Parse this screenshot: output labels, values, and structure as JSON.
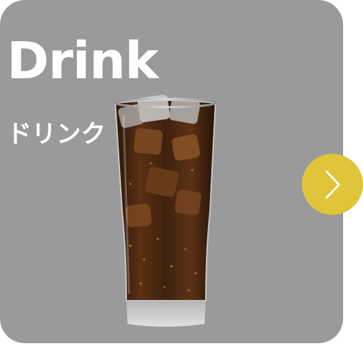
{
  "card": {
    "title_en": "Drink",
    "title_ja": "ドリンク",
    "image_icon": "iced-cola-glass-image",
    "background_color": "#9a9a9a"
  },
  "navigation": {
    "next_icon": "chevron-right-icon",
    "accent_color": "#e0c43a"
  }
}
